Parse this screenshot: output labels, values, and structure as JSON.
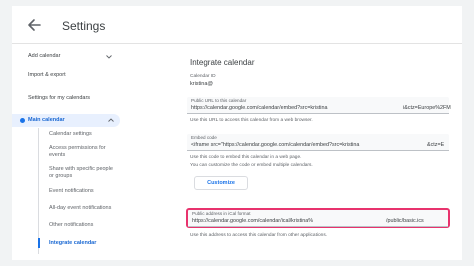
{
  "header": {
    "title": "Settings"
  },
  "sidebar": {
    "add_calendar": "Add calendar",
    "import_export": "Import & export",
    "settings_for_my_calendars": "Settings for my calendars",
    "main_calendar": "Main calendar",
    "sub_items": [
      "Calendar settings",
      "Access permissions for events",
      "Share with specific people or groups",
      "Event notifications",
      "All-day event notifications",
      "Other notifications",
      "Integrate calendar"
    ]
  },
  "main": {
    "section_title": "Integrate calendar",
    "calendar_id_label": "Calendar ID",
    "calendar_id_value": "kristina@",
    "public_url": {
      "label": "Public URL to this calendar",
      "value": "https://calendar.google.com/calendar/embed?src=kristina",
      "value_tail": "i&ctz=Europe%2FM",
      "help": "Use this URL to access this calendar from a web browser."
    },
    "embed_code": {
      "label": "Embed code",
      "value": "<iframe src=\"https://calendar.google.com/calendar/embed?src=kristina",
      "value_tail": "&ctz=E",
      "help1": "Use this code to embed this calendar in a web page.",
      "help2": "You can customize the code or embed multiple calendars."
    },
    "customize_label": "Customize",
    "ical": {
      "label": "Public address in iCal format",
      "value": "https://calendar.google.com/calendar/ical/kristina%",
      "value_tail": "/public/basic.ics",
      "help": "Use this address to access this calendar from other applications."
    }
  },
  "colors": {
    "accent": "#1a73e8",
    "highlight": "#e8336d",
    "active_bg": "#e8f0fe"
  },
  "icons": {
    "back": "arrow-left-icon",
    "expand": "chevron-down-icon",
    "collapse": "chevron-up-icon"
  }
}
